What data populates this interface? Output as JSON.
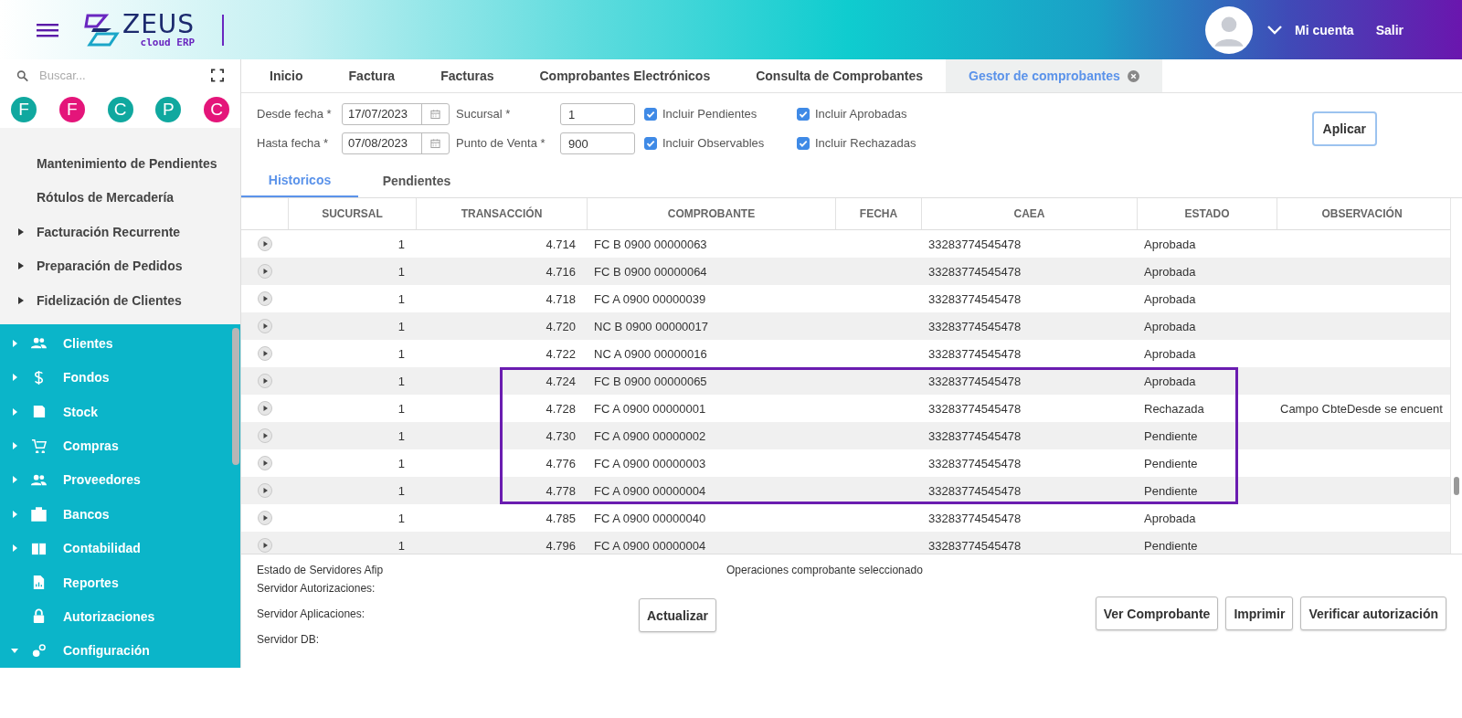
{
  "header": {
    "logo_word": "ZEUS",
    "logo_sub": "cloud ERP",
    "account": "Mi cuenta",
    "logout": "Salir"
  },
  "sidebar": {
    "search": {
      "placeholder": "Buscar..."
    },
    "shortcuts": [
      {
        "letter": "F",
        "color": "#10a89f"
      },
      {
        "letter": "F",
        "color": "#e4157a"
      },
      {
        "letter": "C",
        "color": "#10a89f"
      },
      {
        "letter": "P",
        "color": "#10a89f"
      },
      {
        "letter": "C",
        "color": "#e4157a"
      }
    ],
    "submenu": [
      {
        "label": "Mantenimiento de Pendientes",
        "kind": "leaf"
      },
      {
        "label": "Rótulos de Mercadería",
        "kind": "leaf"
      },
      {
        "label": "Facturación Recurrente",
        "kind": "group",
        "expanded": false
      },
      {
        "label": "Preparación de Pedidos",
        "kind": "group",
        "expanded": false
      },
      {
        "label": "Fidelización de Clientes",
        "kind": "group",
        "expanded": false
      }
    ],
    "modules": [
      {
        "label": "Clientes",
        "kind": "group",
        "expanded": false
      },
      {
        "label": "Fondos",
        "kind": "group",
        "expanded": false
      },
      {
        "label": "Stock",
        "kind": "group",
        "expanded": false
      },
      {
        "label": "Compras",
        "kind": "group",
        "expanded": false
      },
      {
        "label": "Proveedores",
        "kind": "group",
        "expanded": false
      },
      {
        "label": "Bancos",
        "kind": "group",
        "expanded": false
      },
      {
        "label": "Contabilidad",
        "kind": "group",
        "expanded": false
      },
      {
        "label": "Reportes",
        "kind": "leaf"
      },
      {
        "label": "Autorizaciones",
        "kind": "leaf"
      },
      {
        "label": "Configuración",
        "kind": "group",
        "expanded": true
      }
    ]
  },
  "tabs": [
    {
      "label": "Inicio",
      "selected": false,
      "closable": false
    },
    {
      "label": "Factura",
      "selected": false,
      "closable": false
    },
    {
      "label": "Facturas",
      "selected": false,
      "closable": false
    },
    {
      "label": "Comprobantes Electrónicos",
      "selected": false,
      "closable": false
    },
    {
      "label": "Consulta de Comprobantes",
      "selected": false,
      "closable": false
    },
    {
      "label": "Gestor de comprobantes",
      "selected": true,
      "closable": true
    }
  ],
  "filters": {
    "desde": {
      "label": "Desde fecha *",
      "value": "17/07/2023"
    },
    "hasta": {
      "label": "Hasta fecha *",
      "value": "07/08/2023"
    },
    "sucursal": {
      "label": "Sucursal *",
      "value": "1"
    },
    "punto": {
      "label": "Punto de Venta *",
      "value": "900"
    },
    "checks": [
      {
        "label": "Incluir Pendientes",
        "checked": true
      },
      {
        "label": "Incluir Aprobadas",
        "checked": true
      },
      {
        "label": "Incluir Observables",
        "checked": true
      },
      {
        "label": "Incluir Rechazadas",
        "checked": true
      }
    ],
    "apply": "Aplicar"
  },
  "subtabs": [
    {
      "label": "Historicos",
      "selected": true
    },
    {
      "label": "Pendientes",
      "selected": false
    }
  ],
  "table": {
    "columns": [
      "SUCURSAL",
      "TRANSACCIÓN",
      "COMPROBANTE",
      "FECHA",
      "CAEA",
      "ESTADO",
      "OBSERVACIÓN"
    ],
    "rows": [
      {
        "sucursal": "1",
        "transaccion": "4.714",
        "comprobante": "FC B 0900 00000063",
        "caea": "33283774545478",
        "estado": "Aprobada",
        "highlighted": false
      },
      {
        "sucursal": "1",
        "transaccion": "4.716",
        "comprobante": "FC B 0900 00000064",
        "caea": "33283774545478",
        "estado": "Aprobada",
        "highlighted": false
      },
      {
        "sucursal": "1",
        "transaccion": "4.718",
        "comprobante": "FC A 0900 00000039",
        "caea": "33283774545478",
        "estado": "Aprobada",
        "highlighted": false
      },
      {
        "sucursal": "1",
        "transaccion": "4.720",
        "comprobante": "NC B 0900 00000017",
        "caea": "33283774545478",
        "estado": "Aprobada",
        "highlighted": false
      },
      {
        "sucursal": "1",
        "transaccion": "4.722",
        "comprobante": "NC A 0900 00000016",
        "caea": "33283774545478",
        "estado": "Aprobada",
        "highlighted": false
      },
      {
        "sucursal": "1",
        "transaccion": "4.724",
        "comprobante": "FC B 0900 00000065",
        "caea": "33283774545478",
        "estado": "Aprobada",
        "highlighted": true
      },
      {
        "sucursal": "1",
        "transaccion": "4.728",
        "comprobante": "FC A 0900 00000001",
        "caea": "33283774545478",
        "estado": "Rechazada",
        "observacion": "Campo CbteDesde se encuent",
        "highlighted": true
      },
      {
        "sucursal": "1",
        "transaccion": "4.730",
        "comprobante": "FC A 0900 00000002",
        "caea": "33283774545478",
        "estado": "Pendiente",
        "highlighted": true
      },
      {
        "sucursal": "1",
        "transaccion": "4.776",
        "comprobante": "FC A 0900 00000003",
        "caea": "33283774545478",
        "estado": "Pendiente",
        "highlighted": true
      },
      {
        "sucursal": "1",
        "transaccion": "4.778",
        "comprobante": "FC A 0900 00000004",
        "caea": "33283774545478",
        "estado": "Pendiente",
        "highlighted": true
      },
      {
        "sucursal": "1",
        "transaccion": "4.785",
        "comprobante": "FC A 0900 00000040",
        "caea": "33283774545478",
        "estado": "Aprobada",
        "highlighted": false
      },
      {
        "sucursal": "1",
        "transaccion": "4.796",
        "comprobante": "FC A 0900 00000004",
        "caea": "33283774545478",
        "estado": "Pendiente",
        "highlighted": false
      }
    ]
  },
  "servers": {
    "title": "Estado de Servidores Afip",
    "items": [
      "Servidor Autorizaciones:",
      "Servidor Aplicaciones:",
      "Servidor DB:"
    ],
    "refresh": "Actualizar"
  },
  "operations": {
    "title": "Operaciones comprobante seleccionado",
    "buttons": [
      "Ver Comprobante",
      "Imprimir",
      "Verificar autorización"
    ]
  }
}
